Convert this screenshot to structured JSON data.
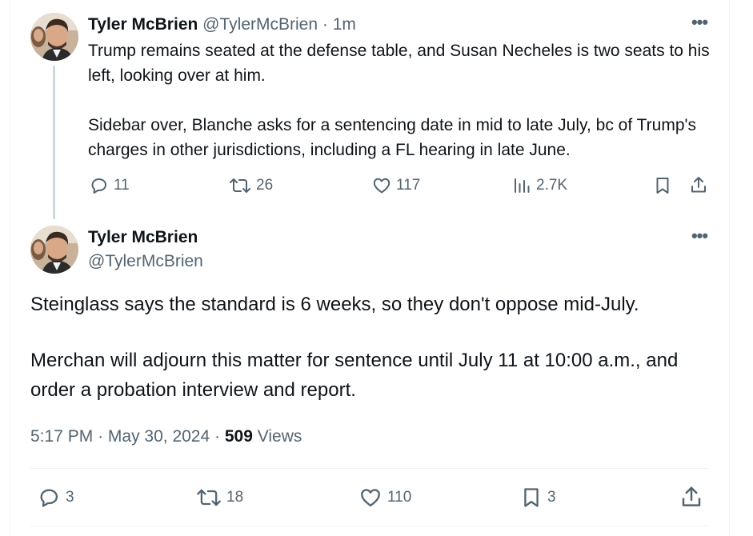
{
  "colors": {
    "text_primary": "#0f1419",
    "text_secondary": "#536471",
    "thread_line": "#cfd9de",
    "divider": "#eff3f4"
  },
  "tweet1": {
    "author_name": "Tyler McBrien",
    "author_handle": "@TylerMcBrien",
    "separator": "·",
    "time": "1m",
    "paragraphs": [
      "Trump remains seated at the defense table, and Susan Necheles is two seats to his left, looking over at him.",
      "Sidebar over, Blanche asks for a sentencing date in mid to late July, bc of Trump's charges in other jurisdictions, including a FL hearing in late June."
    ],
    "actions": {
      "replies": "11",
      "reposts": "26",
      "likes": "117",
      "views": "2.7K"
    },
    "icons": [
      "more-icon",
      "reply-icon",
      "repost-icon",
      "like-icon",
      "views-icon",
      "bookmark-icon",
      "share-icon"
    ]
  },
  "tweet2": {
    "author_name": "Tyler McBrien",
    "author_handle": "@TylerMcBrien",
    "paragraphs": [
      "Steinglass says the standard is 6 weeks, so they don't oppose mid-July.",
      "Merchan will adjourn this matter for sentence until July 11 at 10:00 a.m., and order a probation interview and report."
    ],
    "time": "5:17 PM",
    "separator": "·",
    "date": "May 30, 2024",
    "views_count": "509",
    "views_label": "Views",
    "actions": {
      "replies": "3",
      "reposts": "18",
      "likes": "110",
      "bookmarks": "3"
    },
    "icons": [
      "more-icon",
      "reply-icon",
      "repost-icon",
      "like-icon",
      "bookmark-icon",
      "share-icon"
    ]
  }
}
